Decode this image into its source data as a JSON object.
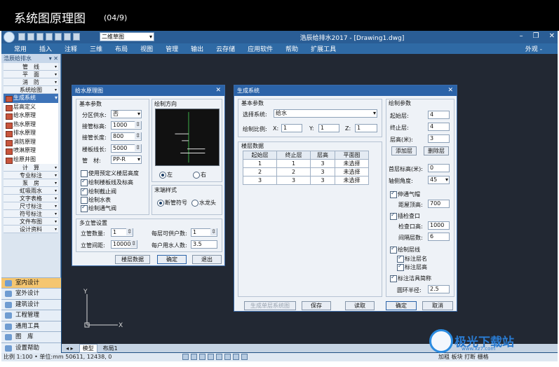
{
  "banner": {
    "title": "系统图原理图",
    "counter": "(04/9)"
  },
  "app": {
    "workspace": "二维草图",
    "doc_title": "浩辰给排水2017 - [Drawing1.dwg]",
    "window_controls": [
      "–",
      "❐",
      "✕"
    ],
    "ribbon_tabs": [
      "常用",
      "插入",
      "注释",
      "三维",
      "布局",
      "视图",
      "管理",
      "输出",
      "云存储",
      "应用软件",
      "帮助",
      "扩展工具"
    ],
    "ribbon_right": "外观 -"
  },
  "left_panel": {
    "header": "浩辰给排水",
    "categories_top": [
      "管　线",
      "平　面",
      "消　防",
      "系统绘图"
    ],
    "tools": [
      "生成系统",
      "层高定义",
      "给水原理",
      "热水原理",
      "排水原理",
      "消防原理",
      "喷淋原理",
      "绘原井图"
    ],
    "categories_mid": [
      "计　算",
      "专业标注",
      "泵　房",
      "虹吸雨水",
      "文字表格",
      "尺寸标注",
      "符号标注",
      "文件布图",
      "设计资料"
    ],
    "bottom_buttons": [
      "室内设计",
      "室外设计",
      "建筑设计",
      "工程管理",
      "通用工具",
      "图　库",
      "设置帮助"
    ]
  },
  "canvas": {
    "tabs": [
      "模型",
      "布局1"
    ],
    "ucs_y": "Y",
    "ucs_x": "X"
  },
  "statusbar": {
    "left": "比例 1:100 • 单位:mm  50611, 12438, 0",
    "right": "加粗  板块  打断  栅格"
  },
  "dlg_water": {
    "title": "给水原理图",
    "basic": "基本参数",
    "supply_label": "分区供水:",
    "supply_value": "否",
    "pipe_height_label": "接管标高:",
    "pipe_height_value": "1000",
    "pipe_length_label": "接管长度:",
    "pipe_length_value": "800",
    "floor_line_label": "楼板线长:",
    "floor_line_value": "5000",
    "material_label": "管　材:",
    "material_value": "PP-R",
    "checks": [
      {
        "label": "使用预定义楼层高度",
        "checked": false
      },
      {
        "label": "绘制楼板线及标高",
        "checked": true
      },
      {
        "label": "绘制截止阀",
        "checked": true
      },
      {
        "label": "绘制水表",
        "checked": false
      },
      {
        "label": "绘制通气阀",
        "checked": true
      }
    ],
    "direction": "绘制方向",
    "dir_left": "左",
    "dir_right": "右",
    "end_style": "末端样式",
    "end_opt1": "断管符号",
    "end_opt2": "水龙头",
    "multi": "多立管设置",
    "riser_count_label": "立管数量:",
    "riser_count_value": "1",
    "riser_gap_label": "立管间距:",
    "riser_gap_value": "10000",
    "households_label": "每层可供户数:",
    "households_value": "1",
    "people_label": "每户用水人数:",
    "people_value": "3.5",
    "btn_floor": "楼层数据",
    "btn_ok": "确定",
    "btn_exit": "退出"
  },
  "dlg_system": {
    "title": "生成系统",
    "basic": "基本参数",
    "system_label": "选择系统:",
    "system_value": "给水",
    "scale_label": "绘制比例:",
    "x_label": "X:",
    "x_value": "1",
    "y_label": "Y:",
    "y_value": "1",
    "z_label": "Z:",
    "z_value": "1",
    "floor_data": "楼层数据",
    "table_headers": [
      "起始层",
      "终止层",
      "层高",
      "平面图"
    ],
    "table_rows": [
      [
        "1",
        "1",
        "3",
        "未选择"
      ],
      [
        "2",
        "2",
        "3",
        "未选择"
      ],
      [
        "3",
        "3",
        "3",
        "未选择"
      ]
    ],
    "btn_gen": "生成单层系统图",
    "btn_save": "保存",
    "btn_read": "读取",
    "draw_params": "绘制参数",
    "start_floor_label": "起始层:",
    "start_floor_value": "4",
    "end_floor_label": "终止层:",
    "end_floor_value": "4",
    "floor_h_label": "层高(米):",
    "floor_h_value": "3",
    "btn_add": "添加层",
    "btn_del": "删除层",
    "first_h_label": "首层标高(米):",
    "first_h_value": "0",
    "angle_label": "轴侧角度:",
    "angle_value": "45",
    "vent_label": "伸通气帽",
    "vent_checked": true,
    "vent_dist_label": "距屋顶高:",
    "vent_dist_value": "700",
    "inspect_label": "插检查口",
    "inspect_checked": true,
    "inspect_h_label": "检查口高:",
    "inspect_h_value": "1000",
    "interval_label": "间隔层数:",
    "interval_value": "6",
    "floorline_label": "绘制层线",
    "floorline_checked": true,
    "floorname_label": "标注层名",
    "floorname_checked": true,
    "floorheight_label": "标注层高",
    "floorheight_checked": true,
    "fixture_label": "标注洁具简称",
    "fixture_checked": true,
    "radius_label": "圆环半径:",
    "radius_value": "2.5",
    "btn_ok": "确定",
    "btn_cancel": "取消"
  },
  "watermark": {
    "text": "极光下载站",
    "sub": "www.xz7.com"
  }
}
